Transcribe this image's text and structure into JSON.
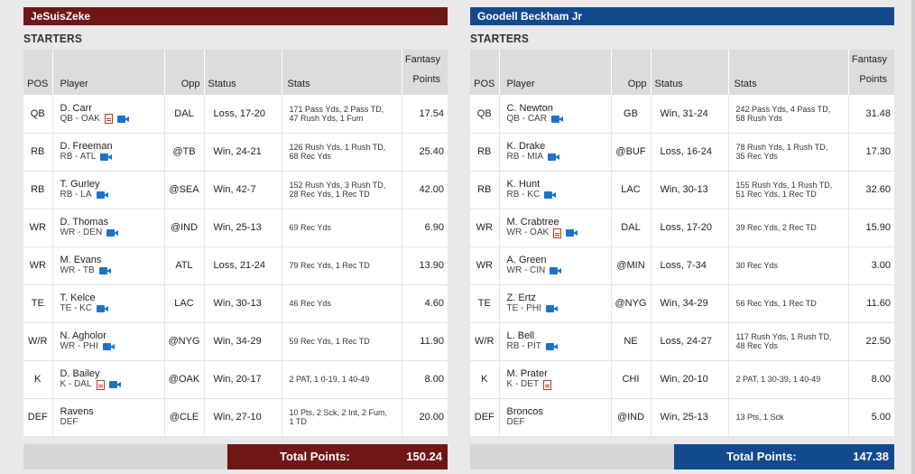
{
  "colors": {
    "left_team": "#6f1716",
    "right_team": "#134a8e"
  },
  "section_label": "STARTERS",
  "headers": {
    "pos": "POS",
    "player": "Player",
    "opp": "Opp",
    "status": "Status",
    "stats": "Stats",
    "points_line1": "Fantasy",
    "points_line2": "Points"
  },
  "total_label": "Total Points:",
  "left": {
    "team_name": "JeSuisZeke",
    "total": "150.24",
    "rows": [
      {
        "pos": "QB",
        "name": "D. Carr",
        "sub": "QB - OAK",
        "news": true,
        "opp": "DAL",
        "status": "Loss, 17-20",
        "stats1": "171 Pass Yds, 2 Pass TD,",
        "stats2": "47 Rush Yds, 1 Fum",
        "points": "17.54"
      },
      {
        "pos": "RB",
        "name": "D. Freeman",
        "sub": "RB - ATL",
        "news": false,
        "opp": "@TB",
        "status": "Win, 24-21",
        "stats1": "126 Rush Yds, 1 Rush TD,",
        "stats2": "68 Rec Yds",
        "points": "25.40"
      },
      {
        "pos": "RB",
        "name": "T. Gurley",
        "sub": "RB - LA",
        "news": false,
        "opp": "@SEA",
        "status": "Win, 42-7",
        "stats1": "152 Rush Yds, 3 Rush TD,",
        "stats2": "28 Rec Yds, 1 Rec TD",
        "points": "42.00"
      },
      {
        "pos": "WR",
        "name": "D. Thomas",
        "sub": "WR - DEN",
        "news": false,
        "opp": "@IND",
        "status": "Win, 25-13",
        "stats1": "69 Rec Yds",
        "stats2": "",
        "points": "6.90"
      },
      {
        "pos": "WR",
        "name": "M. Evans",
        "sub": "WR - TB",
        "news": false,
        "opp": "ATL",
        "status": "Loss, 21-24",
        "stats1": "79 Rec Yds, 1 Rec TD",
        "stats2": "",
        "points": "13.90"
      },
      {
        "pos": "TE",
        "name": "T. Kelce",
        "sub": "TE - KC",
        "news": false,
        "opp": "LAC",
        "status": "Win, 30-13",
        "stats1": "46 Rec Yds",
        "stats2": "",
        "points": "4.60"
      },
      {
        "pos": "W/R",
        "name": "N. Agholor",
        "sub": "WR - PHI",
        "news": false,
        "opp": "@NYG",
        "status": "Win, 34-29",
        "stats1": "59 Rec Yds, 1 Rec TD",
        "stats2": "",
        "points": "11.90"
      },
      {
        "pos": "K",
        "name": "D. Bailey",
        "sub": "K - DAL",
        "news": true,
        "opp": "@OAK",
        "status": "Win, 20-17",
        "stats1": "2 PAT, 1 0-19, 1 40-49",
        "stats2": "",
        "points": "8.00"
      },
      {
        "pos": "DEF",
        "name": "Ravens",
        "sub": "DEF",
        "news": false,
        "video": false,
        "opp": "@CLE",
        "status": "Win, 27-10",
        "stats1": "10 Pts, 2 Sck, 2 Int, 2 Fum,",
        "stats2": "1 TD",
        "points": "20.00"
      }
    ]
  },
  "right": {
    "team_name": "Goodell Beckham Jr",
    "total": "147.38",
    "rows": [
      {
        "pos": "QB",
        "name": "C. Newton",
        "sub": "QB - CAR",
        "news": false,
        "opp": "GB",
        "status": "Win, 31-24",
        "stats1": "242 Pass Yds, 4 Pass TD,",
        "stats2": "58 Rush Yds",
        "points": "31.48"
      },
      {
        "pos": "RB",
        "name": "K. Drake",
        "sub": "RB - MIA",
        "news": false,
        "opp": "@BUF",
        "status": "Loss, 16-24",
        "stats1": "78 Rush Yds, 1 Rush TD,",
        "stats2": "35 Rec Yds",
        "points": "17.30"
      },
      {
        "pos": "RB",
        "name": "K. Hunt",
        "sub": "RB - KC",
        "news": false,
        "opp": "LAC",
        "status": "Win, 30-13",
        "stats1": "155 Rush Yds, 1 Rush TD,",
        "stats2": "51 Rec Yds, 1 Rec TD",
        "points": "32.60"
      },
      {
        "pos": "WR",
        "name": "M. Crabtree",
        "sub": "WR - OAK",
        "news": true,
        "opp": "DAL",
        "status": "Loss, 17-20",
        "stats1": "39 Rec Yds, 2 Rec TD",
        "stats2": "",
        "points": "15.90"
      },
      {
        "pos": "WR",
        "name": "A. Green",
        "sub": "WR - CIN",
        "news": false,
        "opp": "@MIN",
        "status": "Loss, 7-34",
        "stats1": "30 Rec Yds",
        "stats2": "",
        "points": "3.00"
      },
      {
        "pos": "TE",
        "name": "Z. Ertz",
        "sub": "TE - PHI",
        "news": false,
        "opp": "@NYG",
        "status": "Win, 34-29",
        "stats1": "56 Rec Yds, 1 Rec TD",
        "stats2": "",
        "points": "11.60"
      },
      {
        "pos": "W/R",
        "name": "L. Bell",
        "sub": "RB - PIT",
        "news": false,
        "opp": "NE",
        "status": "Loss, 24-27",
        "stats1": "117 Rush Yds, 1 Rush TD,",
        "stats2": "48 Rec Yds",
        "points": "22.50"
      },
      {
        "pos": "K",
        "name": "M. Prater",
        "sub": "K - DET",
        "news": true,
        "video": false,
        "opp": "CHI",
        "status": "Win, 20-10",
        "stats1": "2 PAT, 1 30-39, 1 40-49",
        "stats2": "",
        "points": "8.00"
      },
      {
        "pos": "DEF",
        "name": "Broncos",
        "sub": "DEF",
        "news": false,
        "video": false,
        "opp": "@IND",
        "status": "Win, 25-13",
        "stats1": "13 Pts, 1 Sck",
        "stats2": "",
        "points": "5.00"
      }
    ]
  }
}
